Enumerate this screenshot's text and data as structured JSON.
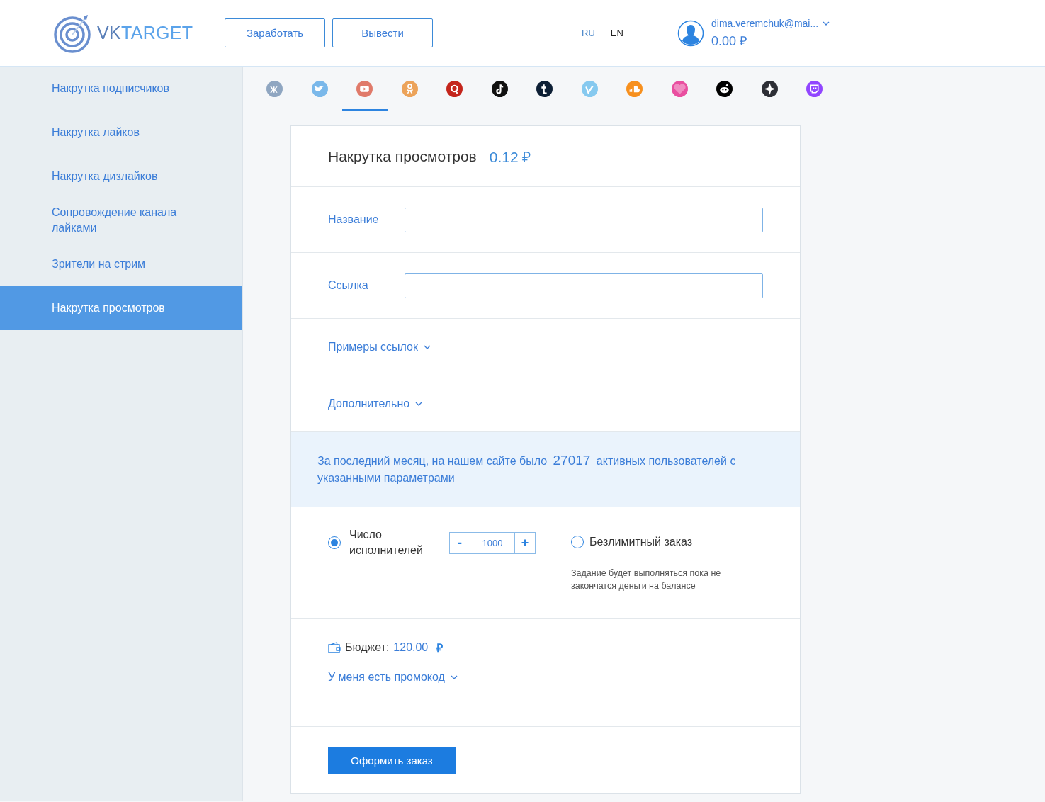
{
  "logo": {
    "part_1": "VK",
    "part_2": "TARGET"
  },
  "header_buttons": [
    "Заработать",
    "Вывести"
  ],
  "languages": [
    {
      "label": "RU",
      "selected": false
    },
    {
      "label": "EN",
      "selected": true
    }
  ],
  "account": {
    "email": "dima.veremchuk@mai...",
    "balance": "0.00 ₽"
  },
  "sidebar": {
    "items": [
      {
        "label": "Накрутка подписчиков",
        "selected": false
      },
      {
        "label": "Накрутка лайков",
        "selected": false
      },
      {
        "label": "Накрутка дизлайков",
        "selected": false
      },
      {
        "label": "Сопровождение канала лайками",
        "selected": false
      },
      {
        "label": "Зрители на стрим",
        "selected": false
      },
      {
        "label": "Накрутка просмотров",
        "selected": true
      }
    ]
  },
  "networks": [
    {
      "kind": "vk",
      "color": "#8fa6c1",
      "selected": false
    },
    {
      "kind": "bird",
      "color": "#7ab8ea",
      "selected": false
    },
    {
      "kind": "play",
      "color": "#e07a6a",
      "selected": true
    },
    {
      "kind": "person",
      "color": "#eca35a",
      "selected": false
    },
    {
      "kind": "ring",
      "color": "#c4251c",
      "selected": false
    },
    {
      "kind": "note",
      "color": "#111111",
      "selected": false
    },
    {
      "kind": "cross",
      "color": "#0d1f35",
      "selected": false
    },
    {
      "kind": "check",
      "color": "#86c9ef",
      "selected": false
    },
    {
      "kind": "cloud",
      "color": "#f7901e",
      "selected": false
    },
    {
      "kind": "heart",
      "color": "#e94fa0",
      "selected": false
    },
    {
      "kind": "face",
      "color": "#000000",
      "selected": false
    },
    {
      "kind": "star",
      "color": "#2d2f36",
      "selected": false
    },
    {
      "kind": "chat",
      "color": "#9146ff",
      "selected": false
    }
  ],
  "form": {
    "title": "Накрутка просмотров",
    "price": "0.12 ₽",
    "fields": [
      {
        "label": "Название"
      },
      {
        "label": "Ссылка"
      }
    ],
    "toggles": [
      {
        "label": "Примеры ссылок",
        "expanded": false
      },
      {
        "label": "Дополнительно",
        "expanded": false
      }
    ],
    "info": {
      "text_before": "За последний месяц, на нашем сайте было",
      "count": "27017",
      "text_after": "активных пользователей с указанными параметрами"
    },
    "options": [
      {
        "label": "Число исполнителей",
        "selected": true,
        "minus": "-",
        "value": "1000",
        "plus": "+"
      },
      {
        "label": "Безлимитный заказ",
        "selected": false,
        "note": "Задание будет выполняться пока не закончатся деньги на балансе"
      }
    ],
    "budget": {
      "label": "Бюджет:",
      "amount": "120.00",
      "currency": "₽"
    },
    "promo": {
      "label": "У меня есть промокод",
      "expanded": false
    },
    "submit": "Оформить заказ"
  }
}
